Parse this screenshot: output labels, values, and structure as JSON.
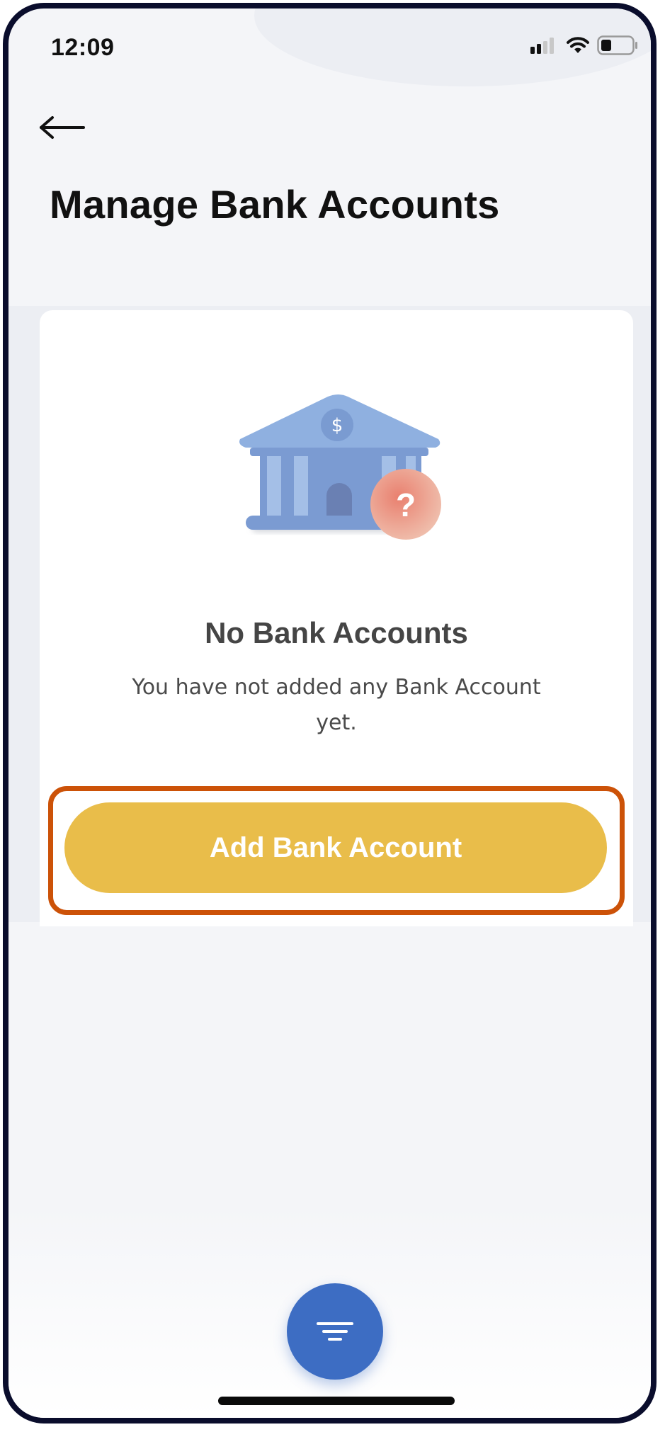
{
  "status_bar": {
    "time": "12:09",
    "icons": [
      "signal-icon",
      "wifi-icon",
      "battery-icon"
    ]
  },
  "header": {
    "back_icon": "arrow-left-icon",
    "title": "Manage Bank Accounts"
  },
  "empty_state": {
    "illustration": "bank-question-icon",
    "illustration_symbols": {
      "currency": "$",
      "question": "?"
    },
    "title": "No Bank Accounts",
    "message": "You have not added any Bank Account yet."
  },
  "primary_action": {
    "label": "Add Bank Account",
    "color": "#e9bd4a",
    "highlight_color": "#cc5208"
  },
  "fab": {
    "icon": "menu-lines-icon",
    "color": "#3d6dc3"
  },
  "colors": {
    "background": "#f4f5f8",
    "bank_blue": "#8fb0e0",
    "question_red": "#e26b62"
  }
}
